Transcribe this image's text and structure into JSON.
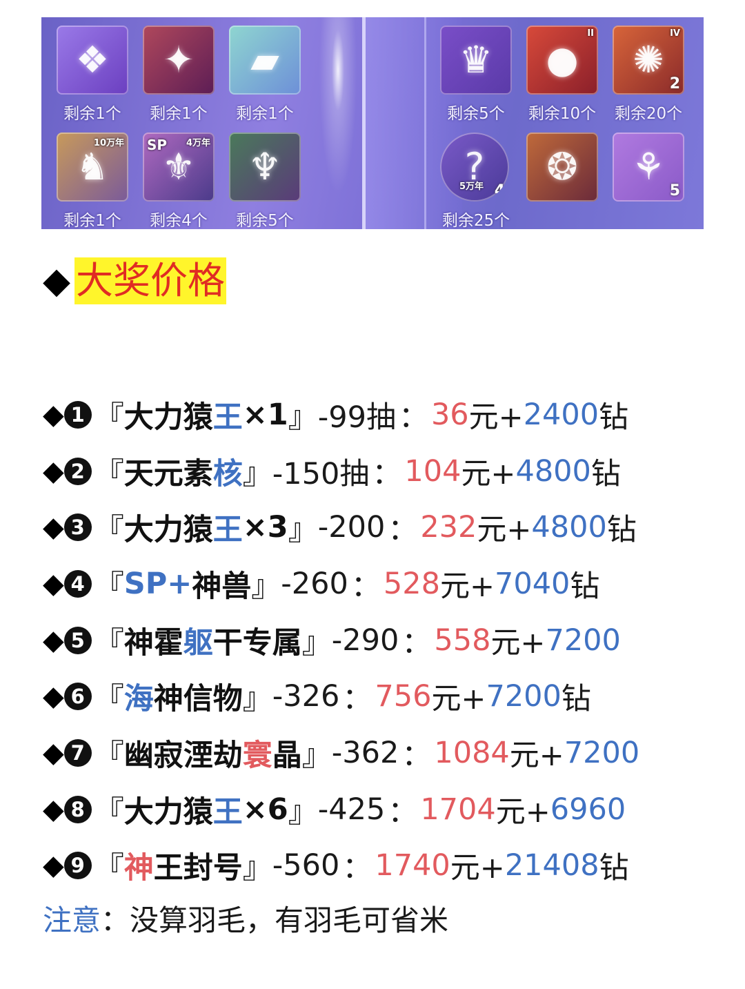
{
  "banner": {
    "left_items": [
      {
        "icon": "chest-icon",
        "remain": "剩余1个"
      },
      {
        "icon": "crimson-crest-icon",
        "remain": "剩余1个"
      },
      {
        "icon": "card-icon",
        "remain": "剩余1个"
      },
      {
        "icon": "soul-ring-hero-icon",
        "badge": "10万年",
        "remain": "剩余1个"
      },
      {
        "icon": "sp-armor-icon",
        "badge": "4万年",
        "badge2": "SP",
        "remain": "剩余4个"
      },
      {
        "icon": "beast-king-icon",
        "remain": "剩余5个"
      }
    ],
    "right_items": [
      {
        "icon": "crown-icon",
        "remain": "剩余5个"
      },
      {
        "icon": "red-orb-icon",
        "badge": "II",
        "remain": "剩余10个"
      },
      {
        "icon": "flame-crest-icon",
        "badge": "IV",
        "count": "2",
        "remain": "剩余20个"
      },
      {
        "icon": "mystery-ring-icon",
        "badge": "5万年",
        "count": "4",
        "remain": "剩余25个"
      },
      {
        "icon": "ornate-chest-icon"
      },
      {
        "icon": "golden-wings-icon",
        "count": "5"
      }
    ]
  },
  "heading": {
    "bullet": "◆",
    "title": "大奖价格"
  },
  "prizes": [
    {
      "num": "1",
      "name_a": "大力猿",
      "name_b": "王",
      "name_c": "×1",
      "draws": "-99抽",
      "rmb": "36",
      "rmb_unit": "元+",
      "dia": "2400",
      "dia_unit": "钻"
    },
    {
      "num": "2",
      "name_a": "天元素",
      "name_b": "核",
      "name_c": "",
      "draws": "-150抽",
      "rmb": "104",
      "rmb_unit": "元+",
      "dia": "4800",
      "dia_unit": "钻"
    },
    {
      "num": "3",
      "name_a": "大力猿",
      "name_b": "王",
      "name_c": "×3",
      "draws": "-200",
      "rmb": "232",
      "rmb_unit": "元+",
      "dia": "4800",
      "dia_unit": "钻"
    },
    {
      "num": "4",
      "name_a": "",
      "name_b": "SP+",
      "name_c": "神兽",
      "draws": "-260",
      "rmb": "528",
      "rmb_unit": "元+",
      "dia": "7040",
      "dia_unit": "钻"
    },
    {
      "num": "5",
      "name_a": "神霍",
      "name_b": "躯",
      "name_c": "干专属",
      "draws": "-290",
      "rmb": "558",
      "rmb_unit": "元+",
      "dia": "7200",
      "dia_unit": ""
    },
    {
      "num": "6",
      "name_a": "",
      "name_b": "海",
      "name_c": "神信物",
      "draws": "-326",
      "rmb": "756",
      "rmb_unit": "元+",
      "dia": "7200",
      "dia_unit": "钻"
    },
    {
      "num": "7",
      "name_a": "幽寂湮劫",
      "name_r": "寰",
      "name_c": "晶",
      "draws": "-362",
      "rmb": "1084",
      "rmb_unit": "元+",
      "dia": "7200",
      "dia_unit": ""
    },
    {
      "num": "8",
      "name_a": "大力猿",
      "name_b": "王",
      "name_c": "×6",
      "draws": "-425",
      "rmb": "1704",
      "rmb_unit": "元+",
      "dia": "6960",
      "dia_unit": ""
    },
    {
      "num": "9",
      "name_a": "",
      "name_r": "神",
      "name_c": "王封号",
      "draws": "-560",
      "rmb": "1740",
      "rmb_unit": "元+",
      "dia": "21408",
      "dia_unit": "钻"
    }
  ],
  "note": {
    "label": "注意",
    "colon": "：",
    "text": "没算羽毛，有羽毛可省米"
  },
  "punct": {
    "open": "『",
    "close": "』",
    "colon": "："
  }
}
